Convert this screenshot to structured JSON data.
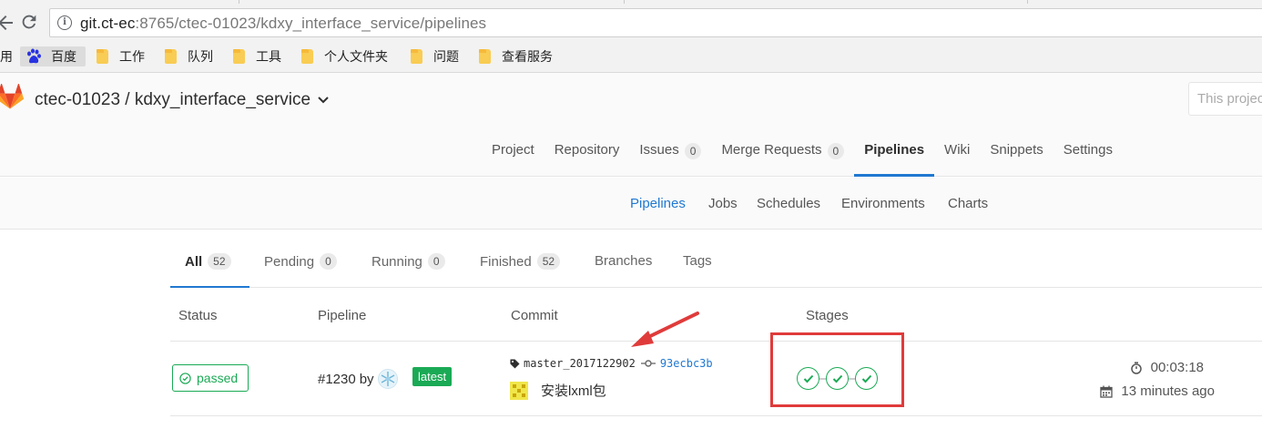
{
  "browser": {
    "url_host": "git.ct-ec",
    "url_rest": ":8765/ctec-01023/kdxy_interface_service/pipelines",
    "back_icon": "arrow-left-icon",
    "reload_icon": "reload-icon",
    "info_icon": "info-icon"
  },
  "bookmarks": [
    {
      "label": "用",
      "icon": null
    },
    {
      "label": "百度",
      "icon": "baidu-icon"
    },
    {
      "label": "工作",
      "icon": "folder-icon"
    },
    {
      "label": "队列",
      "icon": "folder-icon"
    },
    {
      "label": "工具",
      "icon": "folder-icon"
    },
    {
      "label": "个人文件夹",
      "icon": "folder-icon"
    },
    {
      "label": "问题",
      "icon": "folder-icon"
    },
    {
      "label": "查看服务",
      "icon": "folder-icon"
    }
  ],
  "header": {
    "project_title": "ctec-01023 / kdxy_interface_service",
    "search_placeholder": "This project"
  },
  "nav_tabs": [
    {
      "label": "Project"
    },
    {
      "label": "Repository"
    },
    {
      "label": "Issues",
      "count": "0"
    },
    {
      "label": "Merge Requests",
      "count": "0"
    },
    {
      "label": "Pipelines",
      "active": true
    },
    {
      "label": "Wiki"
    },
    {
      "label": "Snippets"
    },
    {
      "label": "Settings"
    }
  ],
  "sub_nav": [
    {
      "label": "Pipelines",
      "active": true
    },
    {
      "label": "Jobs"
    },
    {
      "label": "Schedules"
    },
    {
      "label": "Environments"
    },
    {
      "label": "Charts"
    }
  ],
  "scope_tabs": [
    {
      "label": "All",
      "count": "52",
      "active": true
    },
    {
      "label": "Pending",
      "count": "0"
    },
    {
      "label": "Running",
      "count": "0"
    },
    {
      "label": "Finished",
      "count": "52"
    },
    {
      "label": "Branches"
    },
    {
      "label": "Tags"
    }
  ],
  "table": {
    "headers": [
      "Status",
      "Pipeline",
      "Commit",
      "Stages"
    ],
    "rows": [
      {
        "status": "passed",
        "pipeline_id": "#1230",
        "by": "by",
        "latest_label": "latest",
        "ref": "master_2017122902",
        "sha": "93ecbc3b",
        "message": "安装lxml包",
        "stages": [
          "success",
          "success",
          "success"
        ],
        "duration": "00:03:18",
        "finished": "13 minutes ago"
      }
    ]
  },
  "colors": {
    "success": "#1aaa55",
    "link": "#1f78d1",
    "annotation": "#e03b3b"
  }
}
